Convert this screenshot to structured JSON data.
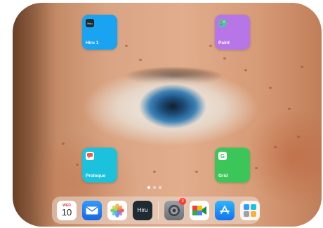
{
  "home_screen": {
    "apps": [
      {
        "label": "Hiru 1",
        "glyph": "Hiru",
        "color": "#1aa3f0"
      },
      {
        "label": "Paint",
        "glyph": "",
        "color": "#b676e8"
      },
      {
        "label": "Proloque",
        "glyph": "",
        "color": "#1cc1dc"
      },
      {
        "label": "Grid",
        "glyph": "G",
        "color": "#3cc65a"
      }
    ],
    "page_indicator": {
      "pages": 3,
      "current": 1
    }
  },
  "dock": {
    "calendar": {
      "weekday": "WED",
      "day": "10"
    },
    "hiru_label": "Hiru",
    "settings_badge": "3",
    "icons": [
      "calendar-icon",
      "mail-icon",
      "photos-icon",
      "hiru-icon",
      "settings-icon",
      "facetime-icon",
      "app-store-icon",
      "app-library-icon"
    ]
  }
}
